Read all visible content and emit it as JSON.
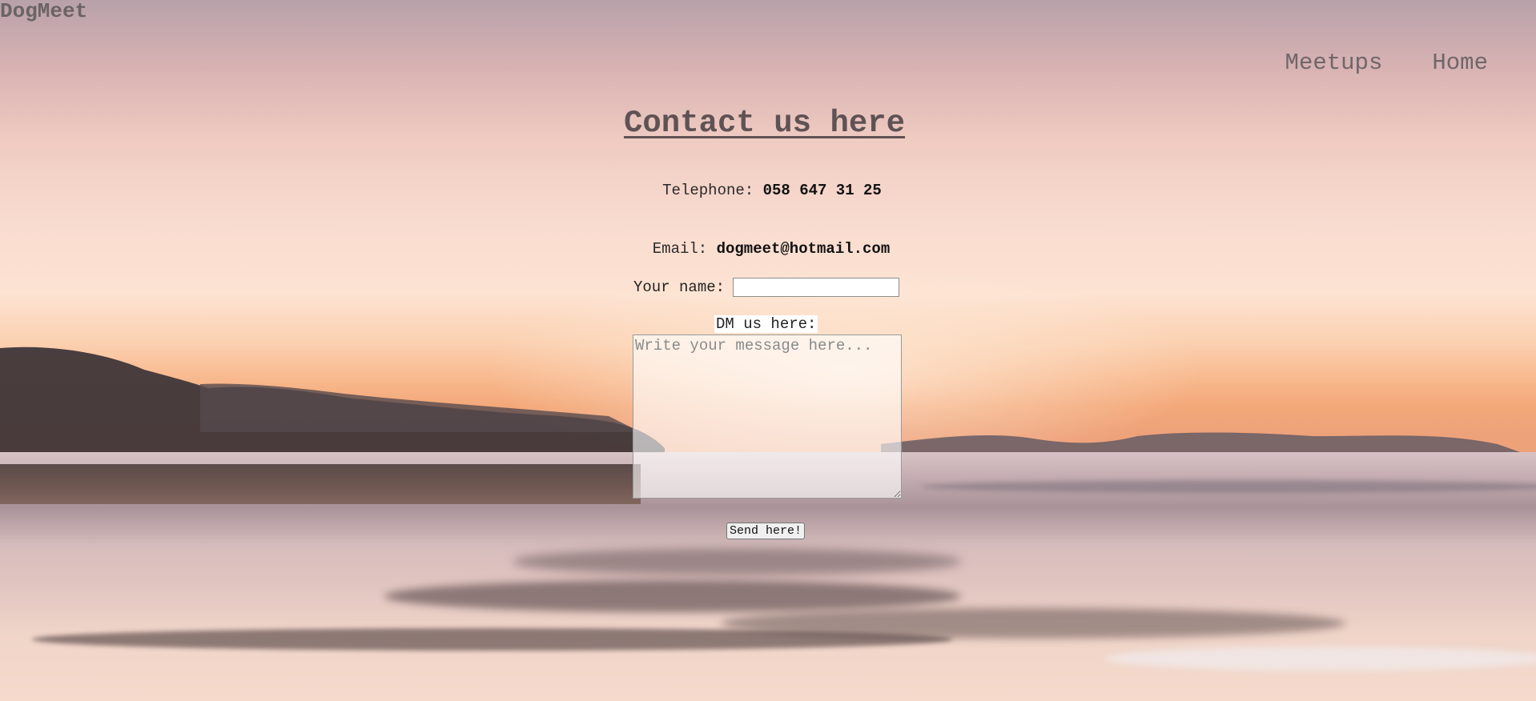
{
  "brand": {
    "logo": "DogMeet"
  },
  "nav": {
    "items": [
      {
        "label": "Meetups"
      },
      {
        "label": "Home"
      }
    ]
  },
  "contact": {
    "title": "Contact us here",
    "telephone_label": "Telephone:",
    "telephone_value": "058 647 31 25",
    "email_label": "Email:",
    "email_value": "dogmeet@hotmail.com",
    "name_label": "Your name:",
    "name_value": "",
    "dm_label": "DM us here:",
    "message_placeholder": "Write your message here...",
    "send_label": "Send here!"
  },
  "colors": {
    "logo": "#6b6366",
    "nav": "#6f6669",
    "title": "#5f5254"
  }
}
